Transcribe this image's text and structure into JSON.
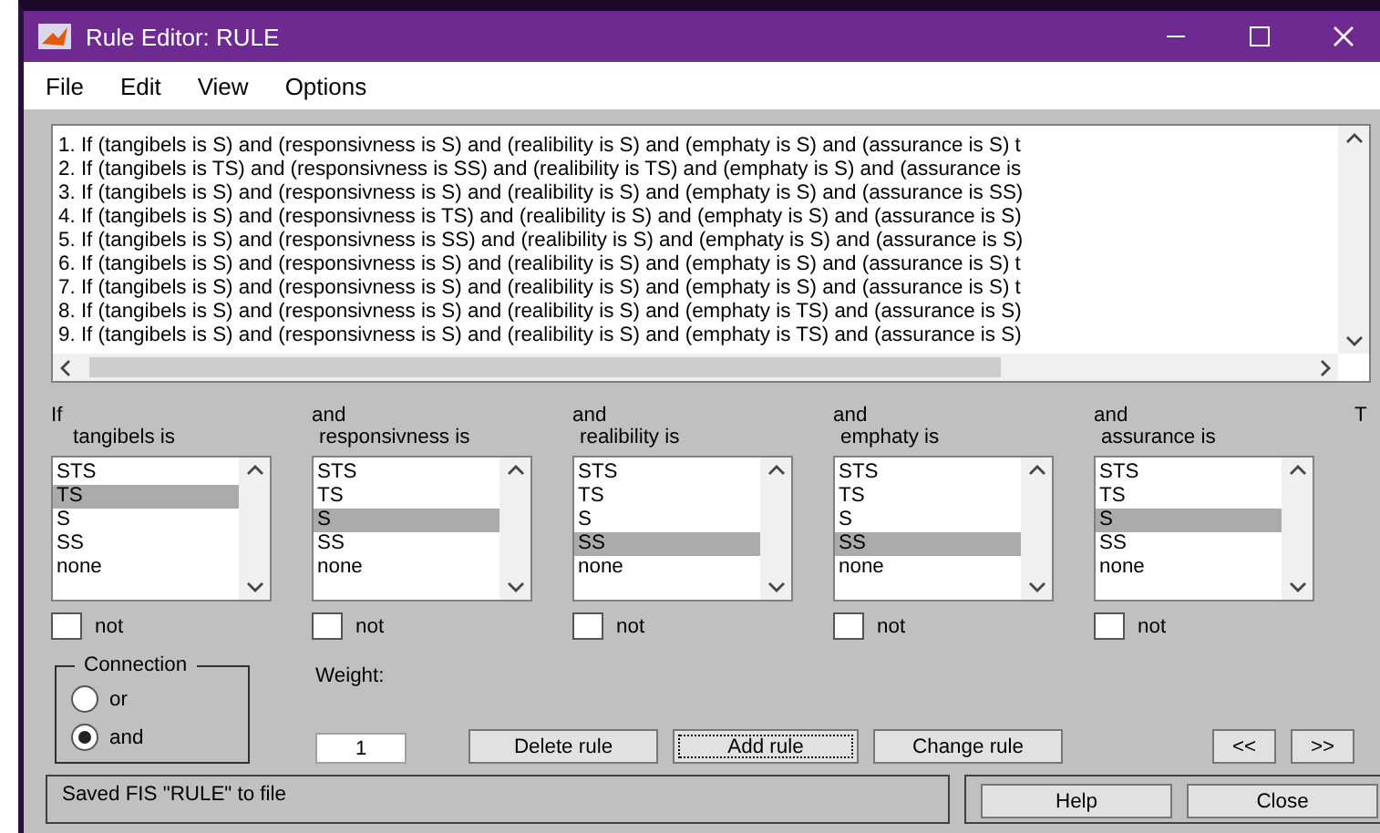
{
  "window": {
    "title": "Rule Editor: RULE"
  },
  "menu": [
    "File",
    "Edit",
    "View",
    "Options"
  ],
  "rules": [
    "1. If (tangibels is S) and (responsivness is S) and (realibility is S) and (emphaty is S) and (assurance is S) t",
    "2. If (tangibels is TS) and (responsivness is SS) and (realibility is TS) and (emphaty is S) and (assurance is",
    "3. If (tangibels is S) and (responsivness is S) and (realibility is S) and (emphaty is S) and (assurance is SS)",
    "4. If (tangibels is S) and (responsivness is TS) and (realibility is S) and (emphaty is S) and (assurance is S)",
    "5. If (tangibels is S) and (responsivness is SS) and (realibility is S) and (emphaty is S) and (assurance is S)",
    "6. If (tangibels is S) and (responsivness is S) and (realibility is S) and (emphaty is S) and (assurance is S) t",
    "7. If (tangibels is S) and (responsivness is S) and (realibility is S) and (emphaty is S) and (assurance is S) t",
    "8. If (tangibels is S) and (responsivness is S) and (realibility is S) and (emphaty is TS) and (assurance is S)",
    "9. If (tangibels is S) and (responsivness is S) and (realibility is S) and (emphaty is TS) and (assurance is S)"
  ],
  "variables": [
    {
      "connector": "If",
      "name": "tangibels is",
      "options": [
        {
          "label": "STS",
          "selected": false
        },
        {
          "label": "TS",
          "selected": true
        },
        {
          "label": "S",
          "selected": false
        },
        {
          "label": "SS",
          "selected": false
        },
        {
          "label": "none",
          "selected": false
        }
      ],
      "not_label": "not",
      "not_checked": false
    },
    {
      "connector": "and",
      "name": "responsivness is",
      "options": [
        {
          "label": "STS",
          "selected": false
        },
        {
          "label": "TS",
          "selected": false
        },
        {
          "label": "S",
          "selected": true
        },
        {
          "label": "SS",
          "selected": false
        },
        {
          "label": "none",
          "selected": false
        }
      ],
      "not_label": "not",
      "not_checked": false
    },
    {
      "connector": "and",
      "name": "realibility is",
      "options": [
        {
          "label": "STS",
          "selected": false
        },
        {
          "label": "TS",
          "selected": false
        },
        {
          "label": "S",
          "selected": false
        },
        {
          "label": "SS",
          "selected": true
        },
        {
          "label": "none",
          "selected": false
        }
      ],
      "not_label": "not",
      "not_checked": false
    },
    {
      "connector": "and",
      "name": "emphaty is",
      "options": [
        {
          "label": "STS",
          "selected": false
        },
        {
          "label": "TS",
          "selected": false
        },
        {
          "label": "S",
          "selected": false
        },
        {
          "label": "SS",
          "selected": true
        },
        {
          "label": "none",
          "selected": false
        }
      ],
      "not_label": "not",
      "not_checked": false
    },
    {
      "connector": "and",
      "name": "assurance is",
      "options": [
        {
          "label": "STS",
          "selected": false
        },
        {
          "label": "TS",
          "selected": false
        },
        {
          "label": "S",
          "selected": true
        },
        {
          "label": "SS",
          "selected": false
        },
        {
          "label": "none",
          "selected": false
        }
      ],
      "not_label": "not",
      "not_checked": false
    },
    {
      "connector": "T"
    }
  ],
  "connection": {
    "title": "Connection",
    "options": [
      {
        "label": "or",
        "selected": false
      },
      {
        "label": "and",
        "selected": true
      }
    ]
  },
  "weight": {
    "label": "Weight:",
    "value": "1"
  },
  "buttons": [
    {
      "label": "Delete rule",
      "focused": false
    },
    {
      "label": "Add rule",
      "focused": true
    },
    {
      "label": "Change rule",
      "focused": false
    }
  ],
  "nav": [
    "<<",
    ">>"
  ],
  "status": "Saved FIS \"RULE\" to file",
  "footer_buttons": [
    "Help",
    "Close"
  ]
}
